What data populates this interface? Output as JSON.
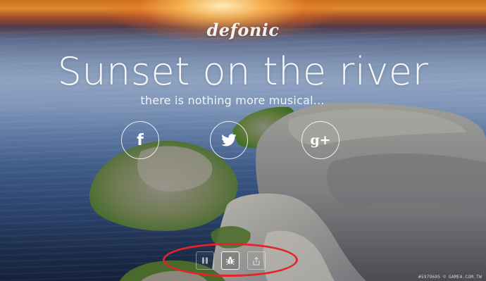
{
  "brand": {
    "logo_text": "defonic"
  },
  "hero": {
    "title": "Sunset on the river",
    "subtitle": "there is nothing more musical..."
  },
  "social": [
    {
      "name": "facebook",
      "glyph": "f",
      "icon": "facebook-icon"
    },
    {
      "name": "twitter",
      "icon": "twitter-icon"
    },
    {
      "name": "google-plus",
      "glyph": "g+",
      "icon": "google-plus-icon"
    }
  ],
  "controls": [
    {
      "name": "pause",
      "icon": "pause-icon"
    },
    {
      "name": "bug",
      "icon": "bug-icon",
      "active": true
    },
    {
      "name": "share",
      "icon": "share-icon"
    }
  ],
  "annotation": {
    "color": "#e5242a"
  },
  "watermark": "#5979605 © GAMEA.COM.TW",
  "colors": {
    "sky_glow": "#e0892c",
    "water_dark": "#1c2c4a",
    "text": "#ffffff"
  }
}
